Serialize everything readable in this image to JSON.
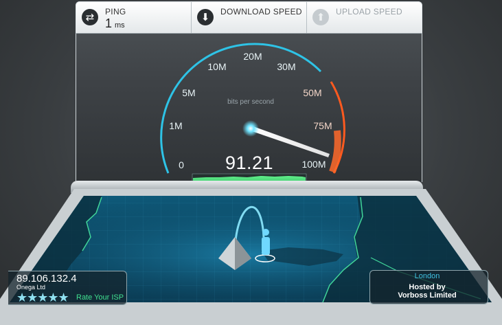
{
  "tests": {
    "ping": {
      "label": "PING",
      "value": "1",
      "unit": "ms",
      "icon": "swap-arrows-icon"
    },
    "download": {
      "label": "DOWNLOAD SPEED",
      "icon": "download-arrow-icon"
    },
    "upload": {
      "label": "UPLOAD SPEED",
      "icon": "upload-arrow-icon"
    }
  },
  "gauge": {
    "caption": "bits per second",
    "reading": "91.21",
    "tick_labels": [
      "0",
      "1M",
      "5M",
      "10M",
      "20M",
      "30M",
      "50M",
      "75M",
      "100M"
    ],
    "needle_value": "91.21",
    "colors": {
      "scale": "#2ec3e6",
      "high_range": "#ff5a1f",
      "graph": "#3ecf6e"
    }
  },
  "client": {
    "ip": "89.106.132.4",
    "isp": "Onega Ltd",
    "stars": "★★★★★",
    "rate_label": "Rate Your ISP"
  },
  "server": {
    "city": "London",
    "hosted_label": "Hosted by",
    "host": "Vorboss Limited"
  }
}
